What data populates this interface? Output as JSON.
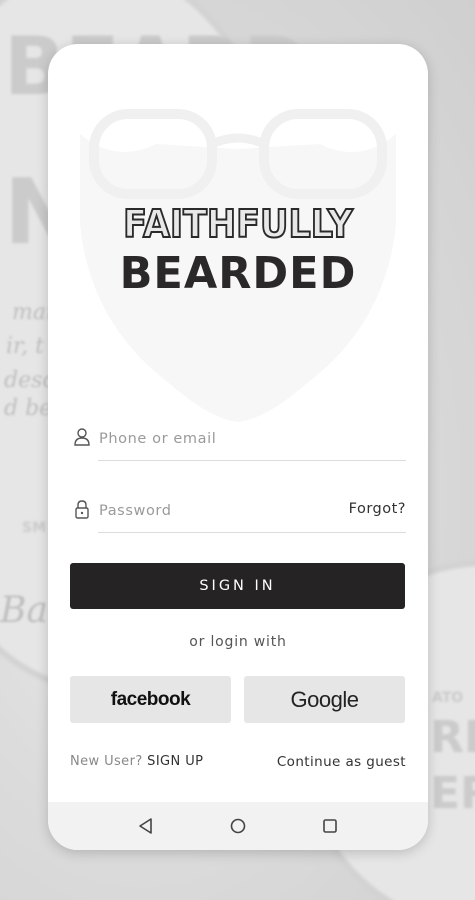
{
  "brand": {
    "line1": "FAITHFULLY",
    "line2": "BEARDED"
  },
  "login": {
    "identifier_placeholder": "Phone or email",
    "password_placeholder": "Password",
    "forgot_label": "Forgot?",
    "signin_label": "SIGN IN",
    "or_login_with": "or login with"
  },
  "social": {
    "facebook_label": "facebook",
    "google_label": "Google"
  },
  "footer": {
    "new_user_text": "New User?",
    "signup_label": "SIGN UP",
    "guest_label": "Continue as guest"
  },
  "background_text": {
    "brand_fragment_1": "BEARD",
    "brand_fragment_2": "N",
    "script_1": "man",
    "script_2": "ir, t",
    "script_3": "desci",
    "script_4": "d be",
    "script_5": "Bar",
    "stamp": "SM",
    "right_fragment_1": "ATO",
    "right_fragment_2": "RD",
    "right_fragment_3": "ER"
  },
  "navigation": {
    "back_icon": "triangle-back-icon",
    "home_icon": "circle-home-icon",
    "recents_icon": "square-recents-icon"
  },
  "colors": {
    "button_dark": "#262324",
    "social_bg": "#e6e6e6",
    "page_bg": "#ffffff"
  }
}
